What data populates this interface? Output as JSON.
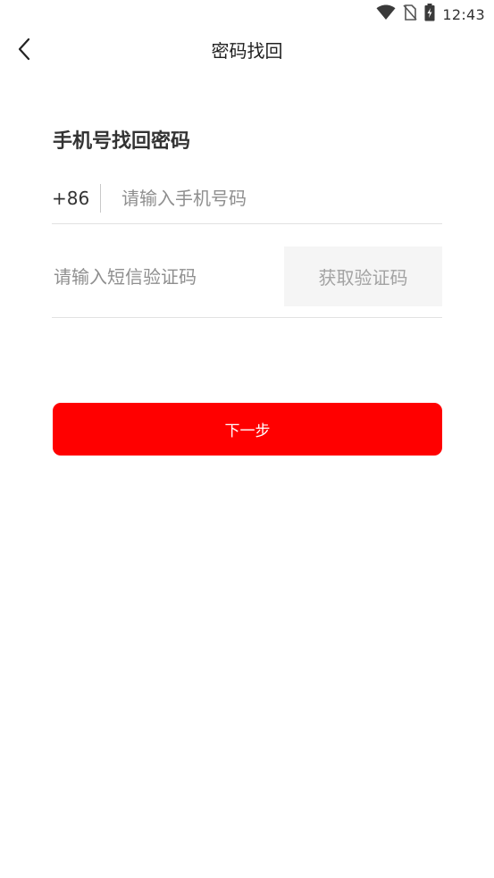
{
  "status_bar": {
    "time": "12:43",
    "icons": [
      "wifi-icon",
      "no-sim-icon",
      "battery-charging-icon"
    ]
  },
  "header": {
    "title": "密码找回",
    "back_icon": "chevron-left-icon"
  },
  "form": {
    "heading": "手机号找回密码",
    "country_code": "+86",
    "phone_placeholder": "请输入手机号码",
    "phone_value": "",
    "sms_placeholder": "请输入短信验证码",
    "sms_value": "",
    "get_code_label": "获取验证码",
    "next_label": "下一步"
  },
  "colors": {
    "accent": "#ff0000",
    "text_primary": "#333333",
    "placeholder": "#8f8f8f",
    "divider": "#e2e2e2",
    "code_button_bg": "#f5f5f5"
  }
}
